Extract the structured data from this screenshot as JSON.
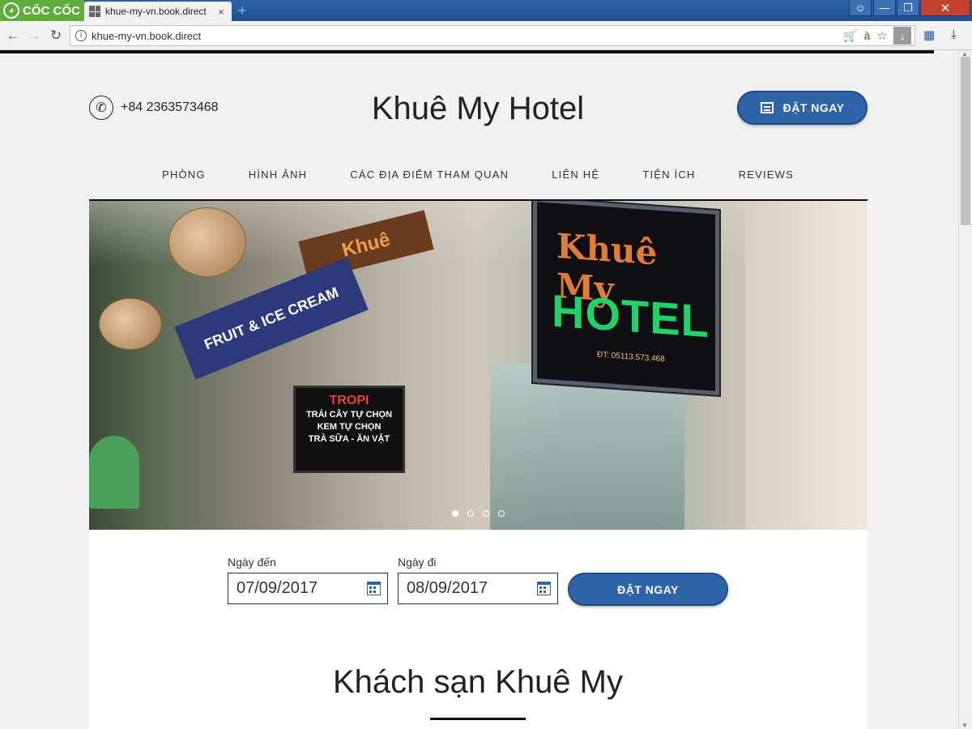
{
  "browser": {
    "brand": "CỐC CỐC",
    "tab_title": "khue-my-vn.book.direct",
    "tab_close": "×",
    "new_tab": "+",
    "url": "khue-my-vn.book.direct",
    "window_controls": {
      "close": "✕"
    },
    "icons": [
      "back-arrow-icon",
      "forward-arrow-icon",
      "reload-icon",
      "info-icon",
      "cart-icon",
      "language-icon",
      "star-icon",
      "download-icon",
      "grid-icon"
    ]
  },
  "header": {
    "phone": "+84 2363573468",
    "site_title": "Khuê My Hotel",
    "book_button": "ĐẶT NGAY"
  },
  "nav": {
    "items": [
      {
        "label": "PHÒNG"
      },
      {
        "label": "HÌNH ẢNH"
      },
      {
        "label": "CÁC ĐỊA ĐIỂM THAM QUAN"
      },
      {
        "label": "LIÊN HỆ"
      },
      {
        "label": "TIỆN ÍCH"
      },
      {
        "label": "REVIEWS"
      }
    ]
  },
  "hero": {
    "slide_count": 4,
    "active_slide": 1,
    "photo_text": {
      "sign_khue": "Khuê My",
      "sign_hotel": "HOTEL",
      "sign_phone": "ĐT: 05113.573.468",
      "sign_tropi_title": "TROPI",
      "sign_tropi_lines": [
        "TRÁI CÂY TỰ CHỌN",
        "KEM TỰ CHỌN",
        "TRÀ SỮA - ĂN VẶT"
      ],
      "sign_fruit": "FRUIT & ICE CREAM",
      "sign_tropi_top": "TROPI",
      "sign_khue_small": "Khuê"
    }
  },
  "booking": {
    "arrival_label": "Ngày đến",
    "arrival_value": "07/09/2017",
    "departure_label": "Ngày đi",
    "departure_value": "08/09/2017",
    "book_button": "ĐẶT NGAY"
  },
  "section": {
    "title": "Khách sạn Khuê My"
  },
  "colors": {
    "accent": "#2f64a8",
    "accent_dark": "#1e4a84",
    "brand_green": "#5fae3c",
    "titlebar": "#2f63a8",
    "close_red": "#c4402f"
  }
}
